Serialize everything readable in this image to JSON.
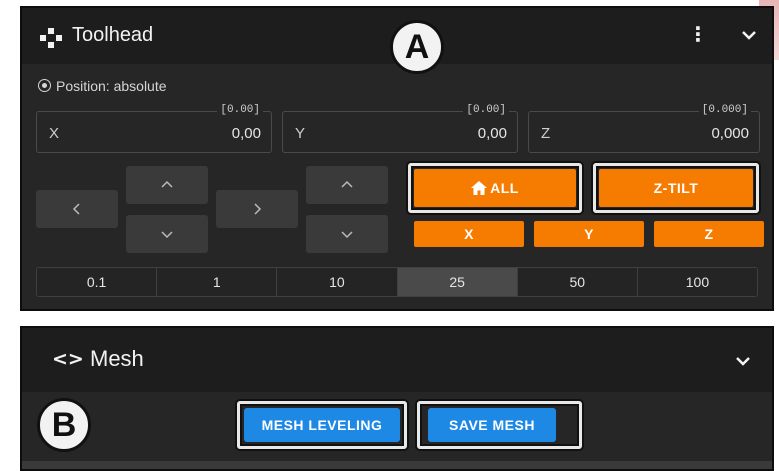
{
  "toolhead": {
    "title": "Toolhead",
    "menu_icon": "vertical-dots-icon",
    "collapse_icon": "chevron-down-icon",
    "position_label": "Position: absolute",
    "fields": [
      {
        "label": "X",
        "value": "0,00",
        "hint": "[0.00]"
      },
      {
        "label": "Y",
        "value": "0,00",
        "hint": "[0.00]"
      },
      {
        "label": "Z",
        "value": "0,000",
        "hint": "[0.000]"
      }
    ],
    "home_all_label": "ALL",
    "ztilt_label": "Z-TILT",
    "home_x_label": "X",
    "home_y_label": "Y",
    "home_z_label": "Z",
    "steps": [
      "0.1",
      "1",
      "10",
      "25",
      "50",
      "100"
    ],
    "selected_step": "25",
    "accent_color": "#f57c00"
  },
  "mesh": {
    "title": "Mesh",
    "icon": "code-brackets-icon",
    "collapse_icon": "chevron-down-icon",
    "mesh_leveling_label": "MESH LEVELING",
    "save_mesh_label": "SAVE MESH",
    "accent_color": "#1e88e5"
  },
  "badges": {
    "a": "A",
    "b": "B"
  }
}
